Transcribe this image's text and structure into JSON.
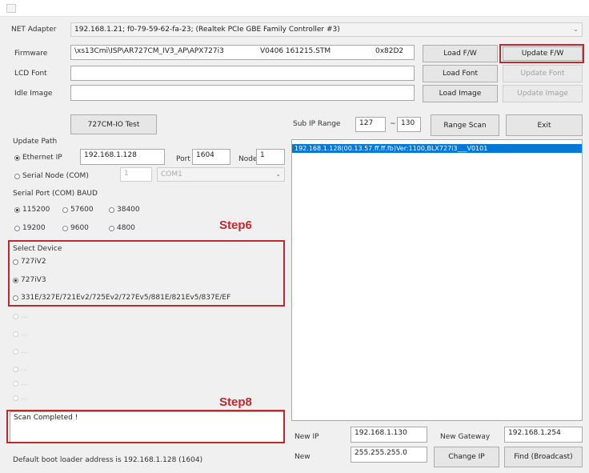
{
  "window": {
    "title": ""
  },
  "net_adapter": {
    "label": "NET Adapter",
    "value": "192.168.1.21;  f0-79-59-62-fa-23;  (Realtek PCIe GBE Family Controller #3)"
  },
  "firmware": {
    "label": "Firmware",
    "path": "\\xs13Cmi\\ISP\\AR727CM_IV3_AP\\APX727i3",
    "version": "V0406 161215.STM",
    "checksum": "0x82D2"
  },
  "lcd_font": {
    "label": "LCD Font",
    "value": ""
  },
  "idle_image": {
    "label": "Idle Image",
    "value": ""
  },
  "buttons": {
    "load_fw": "Load F/W",
    "update_fw": "Update F/W",
    "load_font": "Load Font",
    "update_font": "Update Font",
    "load_image": "Load Image",
    "update_image": "Update Image",
    "io_test": "727CM-IO Test",
    "range_scan": "Range Scan",
    "exit": "Exit",
    "change_ip": "Change IP",
    "find_broadcast": "Find (Broadcast)"
  },
  "sub_ip_range": {
    "label": "Sub IP Range",
    "from": "127",
    "sep": "~",
    "to": "130"
  },
  "update_path": {
    "label": "Update Path",
    "ethernet_label": "Ethernet IP",
    "ethernet_ip": "192.168.1.128",
    "port_label": "Port",
    "port": "1604",
    "node_label": "Node",
    "node": "1",
    "serial_label": "Serial Node (COM)",
    "serial_node": "1",
    "com": "COM1"
  },
  "baud": {
    "label": "Serial Port (COM) BAUD",
    "options": [
      "115200",
      "57600",
      "38400",
      "19200",
      "9600",
      "4800"
    ],
    "selected": "115200"
  },
  "select_device": {
    "label": "Select Device",
    "options": [
      "727iV2",
      "727iV3",
      "331E/327E/721Ev2/725Ev2/727Ev5/881E/821Ev5/837E/EF"
    ],
    "selected": "727iV3",
    "disabled_options": [
      "...",
      "...",
      "...",
      "...",
      "...",
      "...",
      "..."
    ]
  },
  "device_list": {
    "rows": [
      "192.168.1.128(00.13.57.ff.ff.fb)Ver:1100,BLX727i3___V0101"
    ]
  },
  "status": {
    "message": "Scan Completed !",
    "footer": "Default boot loader address is 192.168.1.128 (1604)"
  },
  "network": {
    "new_ip_label": "New IP",
    "new_ip": "192.168.1.130",
    "new_gateway_label": "New Gateway",
    "new_gateway": "192.168.1.254",
    "new_mask_label": "New",
    "new_mask": "255.255.255.0"
  },
  "annotations": {
    "step6": "Step6",
    "step8": "Step8"
  },
  "colors": {
    "accent_red": "#c0282f",
    "selection_blue": "#0078d7"
  }
}
